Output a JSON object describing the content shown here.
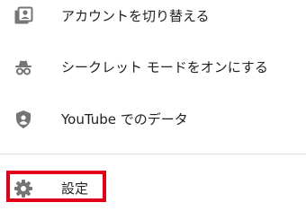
{
  "menu": {
    "items": [
      {
        "label": "アカウントを切り替える",
        "icon": "switch-account-icon"
      },
      {
        "label": "シークレット モードをオンにする",
        "icon": "incognito-icon"
      },
      {
        "label": "YouTube でのデータ",
        "icon": "shield-person-icon"
      },
      {
        "label": "設定",
        "icon": "gear-icon"
      }
    ]
  },
  "colors": {
    "icon": "#757575",
    "text": "#212121",
    "divider": "#e0e0e0",
    "highlight_border": "#e1001a"
  }
}
